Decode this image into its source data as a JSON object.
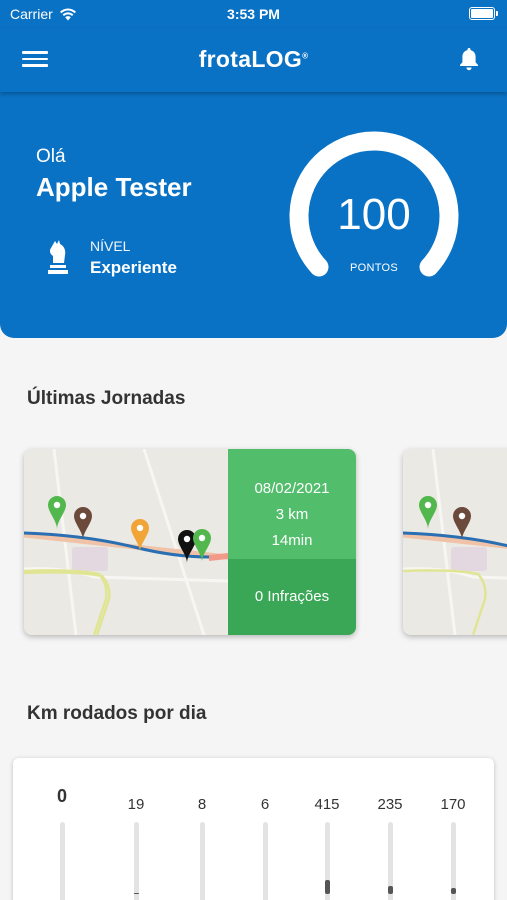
{
  "status_bar": {
    "carrier": "Carrier",
    "time": "3:53 PM"
  },
  "nav": {
    "logo": "frotaLOG",
    "logo_mark": "®",
    "menu_icon": "hamburger-icon",
    "bell_icon": "bell-icon"
  },
  "hero": {
    "greeting": "Olá",
    "user_name": "Apple Tester",
    "level_label": "NÍVEL",
    "level_value": "Experiente",
    "score": "100",
    "score_label": "PONTOS"
  },
  "journeys": {
    "title": "Últimas Jornadas",
    "items": [
      {
        "date": "08/02/2021",
        "distance": "3 km",
        "duration": "14min",
        "infractions": "0 Infrações"
      }
    ]
  },
  "km_chart": {
    "title": "Km rodados por dia"
  },
  "chart_data": {
    "type": "bar",
    "title": "Km rodados por dia",
    "categories": [
      "",
      "",
      "",
      "",
      "",
      "",
      ""
    ],
    "values": [
      0,
      19,
      8,
      6,
      415,
      235,
      170
    ],
    "value_labels": [
      "0",
      "19",
      "8",
      "6",
      "415",
      "235",
      "170"
    ]
  },
  "colors": {
    "primary": "#0a72c4",
    "card_green": "#52be6c",
    "card_green_dark": "#3aa757"
  }
}
